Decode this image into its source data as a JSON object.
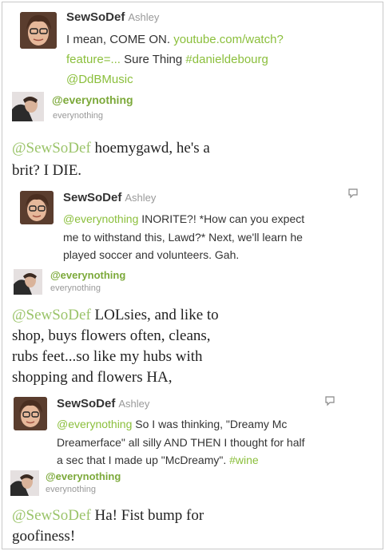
{
  "thread": {
    "t1": {
      "username": "SewSoDef",
      "realname": "Ashley",
      "line1": "I mean, COME ON.",
      "link1": "youtube.com/watch?",
      "link2": "feature=...",
      "line2": "Sure Thing",
      "hashtag": "#danieldebourg",
      "mention": "@DdBMusic"
    },
    "e1": {
      "handle": "@everynothing",
      "sub": "everynothing"
    },
    "r1": {
      "mention": "@SewSoDef",
      "line1": "hoemygawd, he's a",
      "line2": "brit? I DIE."
    },
    "t2": {
      "username": "SewSoDef",
      "realname": "Ashley",
      "mention": "@everynothing",
      "line1": "INORITE?! *How can you expect",
      "line2": "me to withstand this, Lawd?* Next, we'll learn he",
      "line3": "played soccer and volunteers. Gah."
    },
    "e2": {
      "handle": "@everynothing",
      "sub": "everynothing"
    },
    "r2": {
      "mention": "@SewSoDef",
      "line1": "LOLsies, and like to",
      "line2": "shop, buys flowers often, cleans,",
      "line3": "rubs feet...so like my hubs with",
      "line4": "shopping and flowers HA,"
    },
    "t3": {
      "username": "SewSoDef",
      "realname": "Ashley",
      "mention": "@everynothing",
      "line1": "So I was thinking, \"Dreamy Mc",
      "line2": "Dreamerface\" all silly AND THEN I thought for half",
      "line3": "a sec that I made up \"McDreamy\".",
      "hashtag": "#wine"
    },
    "e3": {
      "handle": "@everynothing",
      "sub": "everynothing"
    },
    "r3": {
      "mention": "@SewSoDef",
      "line1": "Ha! Fist bump for",
      "line2": "goofiness!"
    }
  },
  "colors": {
    "link_green": "#8bbf3c",
    "handle_green": "#7ca93a",
    "muted": "#999999"
  },
  "icons": {
    "reply": "reply-icon"
  }
}
